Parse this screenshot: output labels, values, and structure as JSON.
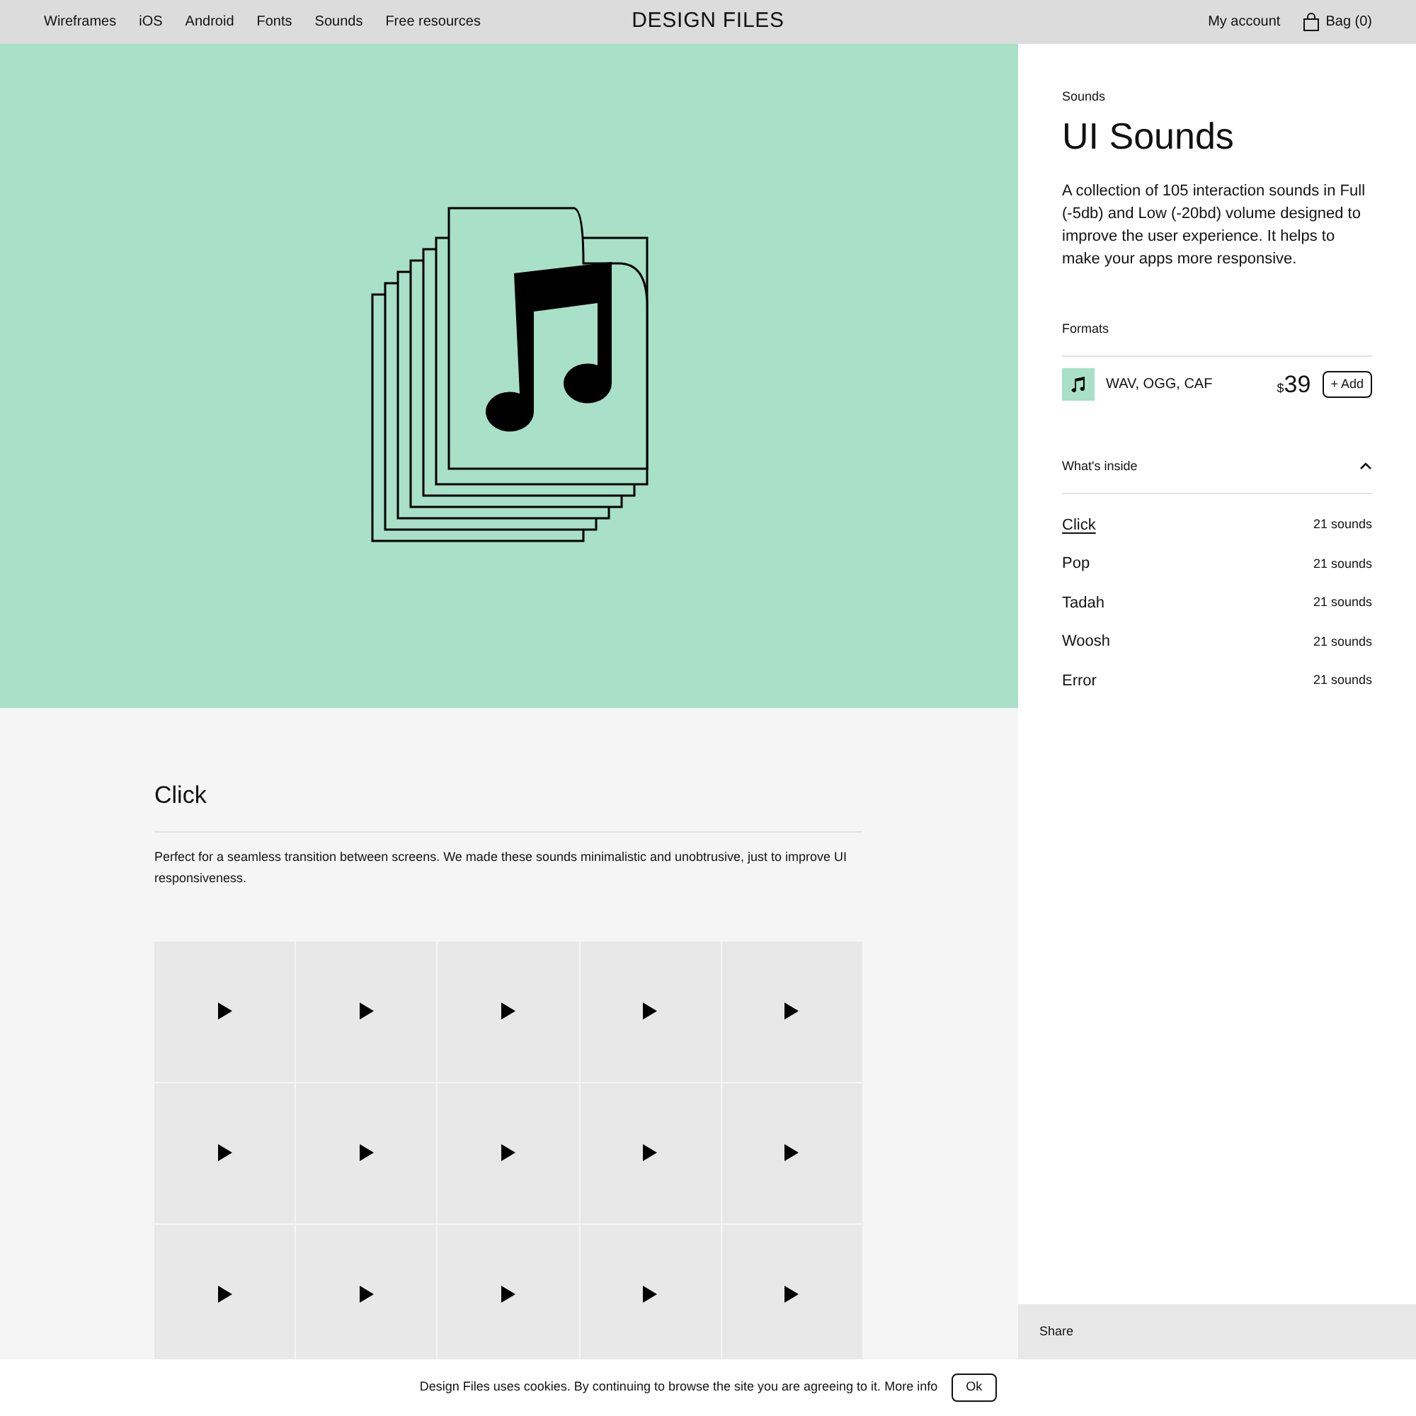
{
  "nav": {
    "links": [
      "Wireframes",
      "iOS",
      "Android",
      "Fonts",
      "Sounds",
      "Free resources"
    ],
    "logo": "DESIGN FILES",
    "account": "My account",
    "bag": "Bag (0)"
  },
  "product": {
    "category": "Sounds",
    "title": "UI Sounds",
    "description": "A collection of 105 interaction sounds in Full (-5db) and Low (-20bd) volume designed to improve the user experience. It helps to make your apps more responsive.",
    "formats_label": "Formats",
    "format": {
      "name": "WAV, OGG, CAF",
      "currency": "$",
      "price": "39",
      "add": "+ Add"
    },
    "inside": {
      "label": "What's inside",
      "expanded": true,
      "items": [
        {
          "name": "Click",
          "count": "21 sounds",
          "selected": true
        },
        {
          "name": "Pop",
          "count": "21 sounds",
          "selected": false
        },
        {
          "name": "Tadah",
          "count": "21 sounds",
          "selected": false
        },
        {
          "name": "Woosh",
          "count": "21 sounds",
          "selected": false
        },
        {
          "name": "Error",
          "count": "21 sounds",
          "selected": false
        }
      ]
    },
    "share": "Share"
  },
  "section": {
    "title": "Click",
    "description": "Perfect for a seamless transition between screens. We made these sounds minimalistic and unobtrusive, just to improve UI responsiveness.",
    "tiles": [
      {
        "playing": false
      },
      {
        "playing": false
      },
      {
        "playing": false
      },
      {
        "playing": false
      },
      {
        "playing": false
      },
      {
        "playing": false
      },
      {
        "playing": false
      },
      {
        "playing": false
      },
      {
        "playing": false
      },
      {
        "playing": false
      },
      {
        "playing": false
      },
      {
        "playing": false
      },
      {
        "playing": false
      },
      {
        "playing": false
      },
      {
        "playing": false
      }
    ]
  },
  "cookie": {
    "text": "Design Files uses cookies. By continuing to browse the site you are agreeing to it.",
    "link": "More info",
    "button": "Ok"
  }
}
